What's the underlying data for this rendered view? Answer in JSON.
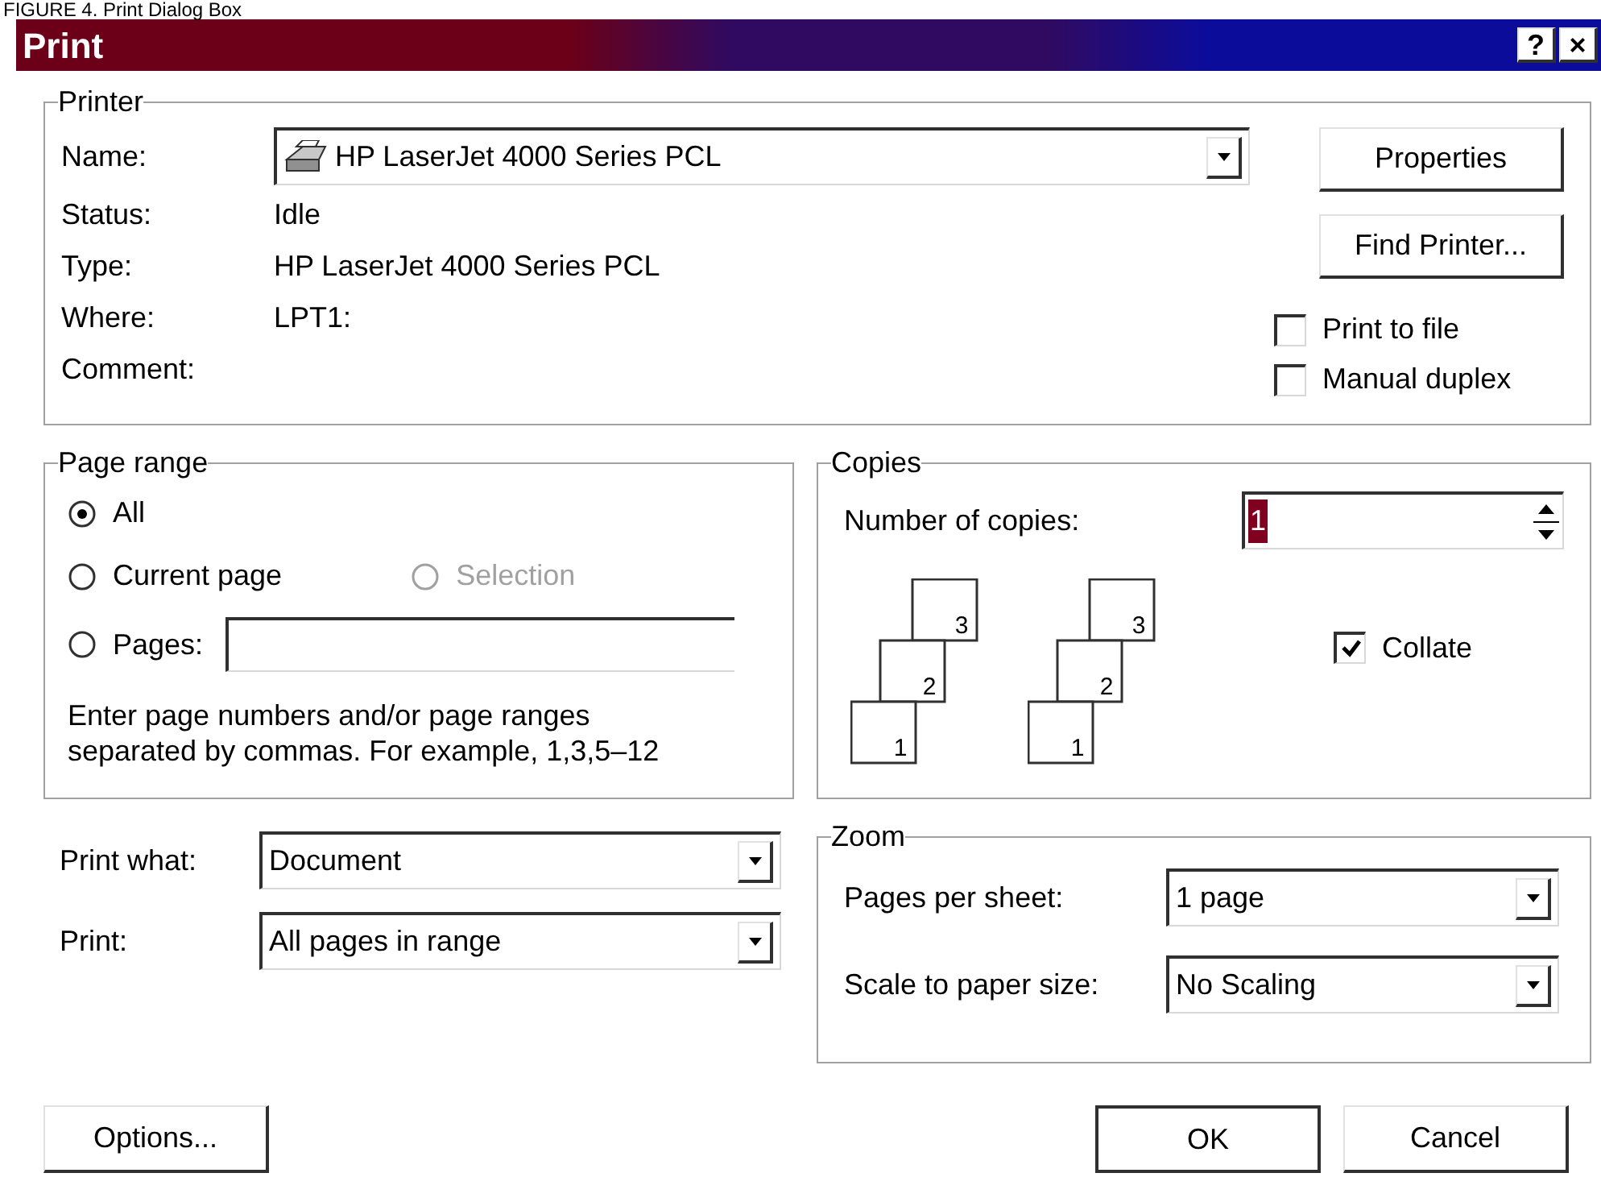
{
  "caption": "FIGURE 4. Print Dialog Box",
  "window": {
    "title": "Print",
    "title_buttons": [
      "?",
      "×"
    ]
  },
  "printer": {
    "title": "Printer",
    "name_label": "Name:",
    "name_value": "HP LaserJet 4000 Series PCL",
    "properties_button": "Properties",
    "find_button": "Find Printer...",
    "info": [
      {
        "label": "Status:",
        "value": "Idle"
      },
      {
        "label": "Type:",
        "value": "HP LaserJet 4000 Series PCL"
      },
      {
        "label": "Where:",
        "value": "LPT1:"
      },
      {
        "label": "Comment:"
      }
    ],
    "options": [
      {
        "label": "Print to file",
        "checked": false
      },
      {
        "label": "Manual duplex",
        "checked": false
      }
    ]
  },
  "page_range": {
    "title": "Page range",
    "options": [
      {
        "label": "All",
        "selected": true,
        "disabled": false
      },
      {
        "label": "Current page",
        "selected": false,
        "disabled": false
      },
      {
        "label": "Selection",
        "selected": false,
        "disabled": true
      },
      {
        "label": "Pages:",
        "selected": false,
        "disabled": false
      }
    ],
    "hint_lines": [
      "Enter page numbers and/or page ranges",
      "separated by commas.  For example, 1,3,5–12"
    ]
  },
  "copies": {
    "title": "Copies",
    "count_label": "Number of copies:",
    "count_value": "1",
    "stacks": [
      [
        "3",
        "2",
        "1"
      ],
      [
        "3",
        "2",
        "1"
      ]
    ],
    "collate": {
      "label": "Collate",
      "checked": true
    }
  },
  "print_what": [
    {
      "label": "Print what:",
      "value": "Document"
    },
    {
      "label": "Print:",
      "value": "All pages in range"
    }
  ],
  "zoom": {
    "title": "Zoom",
    "fields": [
      {
        "label": "Pages per sheet:",
        "value": "1 page"
      },
      {
        "label": "Scale to paper size:",
        "value": "No Scaling"
      }
    ]
  },
  "buttons": {
    "options": "Options...",
    "ok": "OK",
    "cancel": "Cancel"
  }
}
